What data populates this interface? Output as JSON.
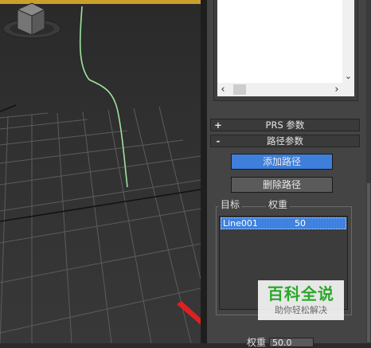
{
  "right_panel": {
    "rollouts": [
      {
        "sign": "+",
        "title": "PRS 参数"
      },
      {
        "sign": "-",
        "title": "路径参数"
      }
    ],
    "buttons": {
      "add_path": "添加路径",
      "delete_path": "删除路径"
    },
    "group": {
      "target_label": "目标",
      "weight_label": "权重"
    },
    "target_list": {
      "rows": [
        {
          "name": "Line001",
          "weight": "50"
        }
      ]
    },
    "weight_spinner": {
      "label": "权重",
      "value": "50.0"
    }
  },
  "watermark": {
    "title": "百科全说",
    "subtitle": "助你轻松解决"
  },
  "colors": {
    "accent_blue": "#3e7fdc",
    "path_line": "#9fe3a0",
    "viewport_border": "#c9a02a",
    "annotation_arrow": "#e02020"
  },
  "icons": [
    "view-cube-icon",
    "chevron-down-icon",
    "chevron-left-icon",
    "chevron-right-icon"
  ]
}
